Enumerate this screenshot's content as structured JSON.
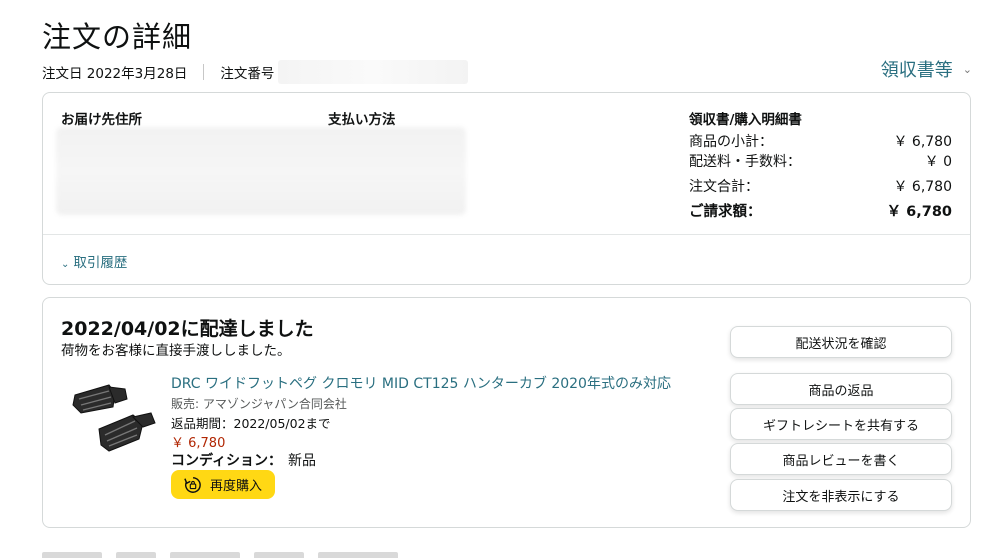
{
  "header": {
    "title": "注文の詳細",
    "order_date": "注文日 2022年3月28日",
    "order_number_label": "注文番号",
    "receipts_link": "領収書等"
  },
  "summary_card": {
    "shipping_address_heading": "お届け先住所",
    "payment_method_heading": "支払い方法",
    "receipt_heading": "領収書/購入明細書",
    "rows": [
      {
        "label": "商品の小計：",
        "value": "￥ 6,780"
      },
      {
        "label": "配送料・手数料：",
        "value": "￥ 0"
      },
      {
        "label": "注文合計：",
        "value": "￥ 6,780"
      },
      {
        "label": "ご請求額：",
        "value": "￥ 6,780"
      }
    ],
    "history_link": "取引履歴"
  },
  "shipment": {
    "delivered_title": "2022/04/02に配達しました",
    "delivered_note": "荷物をお客様に直接手渡ししました。",
    "product_name": "DRC ワイドフットペグ クロモリ MID CT125 ハンターカブ 2020年式のみ対応",
    "seller": "販売: アマゾンジャパン合同会社",
    "return_window": "返品期間：2022/05/02まで",
    "price": "￥ 6,780",
    "condition_label": "コンディション：",
    "condition_value": "新品",
    "rebuy_label": "再度購入",
    "actions": [
      "配送状況を確認",
      "商品の返品",
      "ギフトレシートを共有する",
      "商品レビューを書く",
      "注文を非表示にする"
    ]
  },
  "colors": {
    "link": "#2a6f80",
    "price": "#b12704",
    "rebuy_bg": "#ffd814"
  }
}
